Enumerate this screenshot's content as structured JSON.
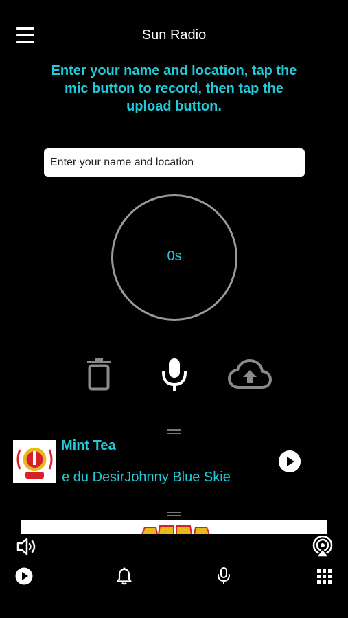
{
  "header": {
    "title": "Sun Radio",
    "menu_icon": "hamburger-menu-icon"
  },
  "instructions": "Enter your name and location, tap the mic button to record, then tap the upload button.",
  "name_input": {
    "placeholder": "Enter your name and location",
    "value": ""
  },
  "recorder": {
    "elapsed": "0s"
  },
  "controls": {
    "delete_icon": "trash-icon",
    "record_icon": "microphone-icon",
    "upload_icon": "cloud-upload-icon"
  },
  "now_playing": {
    "title": "Mint Tea",
    "ticker": "ge du DesirJohnny Blue Skie",
    "logo_icon": "sun-radio-logo",
    "play_icon": "play-icon"
  },
  "bottom_bar": {
    "volume_icon": "speaker-icon",
    "airplay_icon": "airplay-icon",
    "tabs": [
      {
        "icon": "play-circle-icon"
      },
      {
        "icon": "bell-icon"
      },
      {
        "icon": "microphone-icon"
      },
      {
        "icon": "grid-icon"
      }
    ]
  },
  "colors": {
    "accent": "#22c9d8",
    "background": "#000000",
    "ring": "#9a9a9a",
    "control_gray": "#8a8a8a"
  }
}
